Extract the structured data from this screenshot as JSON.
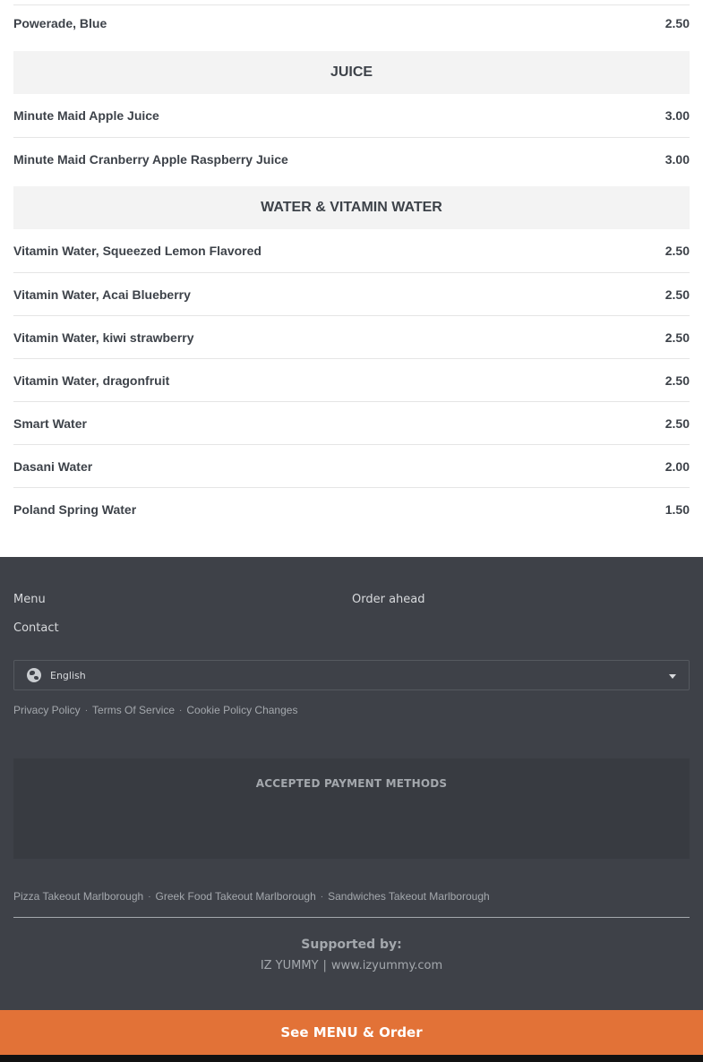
{
  "menu": {
    "top_item": {
      "name": "Powerade, Blue",
      "price": "2.50"
    },
    "sections": [
      {
        "title": "JUICE",
        "items": [
          {
            "name": "Minute Maid Apple Juice",
            "price": "3.00"
          },
          {
            "name": "Minute Maid Cranberry Apple Raspberry Juice",
            "price": "3.00"
          }
        ]
      },
      {
        "title": "WATER & VITAMIN WATER",
        "items": [
          {
            "name": "Vitamin Water, Squeezed Lemon Flavored",
            "price": "2.50"
          },
          {
            "name": "Vitamin Water, Acai Blueberry",
            "price": "2.50"
          },
          {
            "name": "Vitamin Water, kiwi strawberry",
            "price": "2.50"
          },
          {
            "name": "Vitamin Water, dragonfruit",
            "price": "2.50"
          },
          {
            "name": "Smart Water",
            "price": "2.50"
          },
          {
            "name": "Dasani Water",
            "price": "2.00"
          },
          {
            "name": "Poland Spring Water",
            "price": "1.50"
          }
        ]
      }
    ]
  },
  "footer": {
    "links": {
      "menu": "Menu",
      "order_ahead": "Order ahead",
      "contact": "Contact"
    },
    "language": {
      "selected": "English",
      "icon": "globe-icon"
    },
    "legal": {
      "privacy": "Privacy Policy",
      "terms": "Terms Of Service",
      "cookies": "Cookie Policy Changes",
      "separator": "·"
    },
    "payments_title": "ACCEPTED PAYMENT METHODS",
    "seo_links": [
      "Pizza Takeout Marlborough",
      "Greek Food Takeout Marlborough",
      "Sandwiches Takeout Marlborough"
    ],
    "supported_by": {
      "title": "Supported by:",
      "name": "IZ YUMMY",
      "divider": "|",
      "url": "www.izyummy.com"
    }
  },
  "cta": {
    "label": "See MENU & Order"
  },
  "colors": {
    "footer_bg": "#3e4148",
    "cta_bg": "#e27237",
    "section_bg": "#f3f3f3",
    "text": "#3d4249"
  }
}
